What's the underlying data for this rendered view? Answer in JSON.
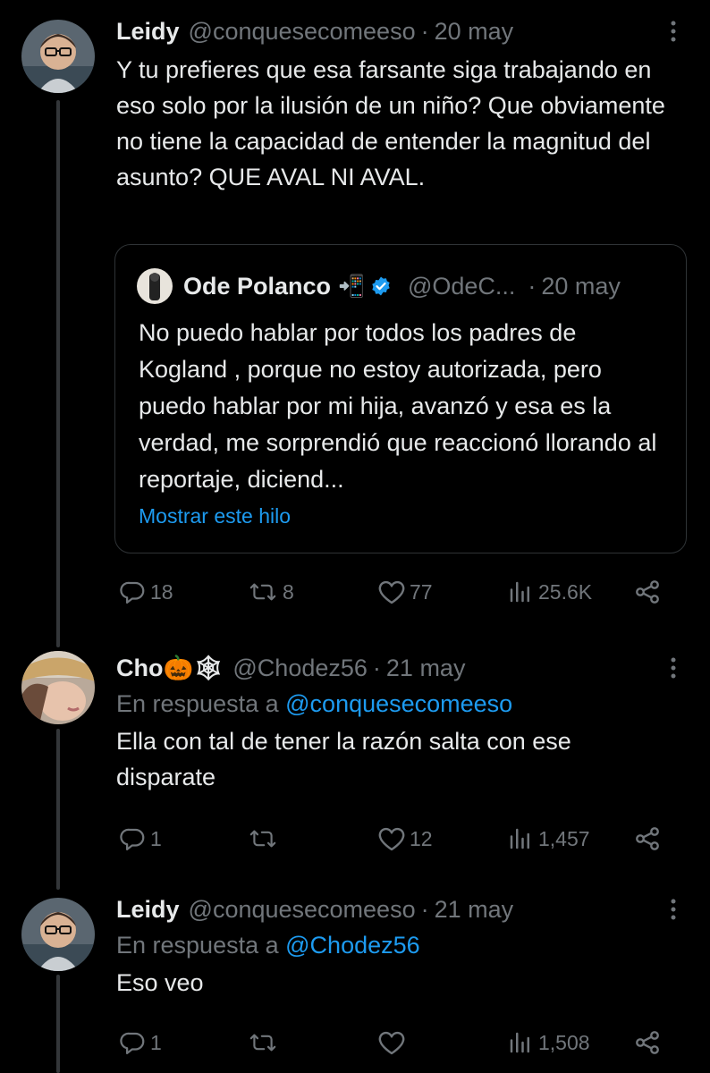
{
  "colors": {
    "background": "#000000",
    "text": "#e7e9ea",
    "muted": "#71767b",
    "link": "#1d9bf0",
    "border": "#2f3336",
    "verified": "#1d9bf0"
  },
  "tweets": [
    {
      "name": "Leidy",
      "handle": "@conquesecomeeso",
      "date": "20 may",
      "text": "Y tu prefieres que esa farsante siga trabajando en eso solo por la ilusión de un niño? Que obviamente no tiene la capacidad de entender la magnitud del asunto? QUE AVAL NI AVAL.",
      "quote": {
        "name": "Ode Polanco",
        "emoji": "📲",
        "verified": true,
        "handle": "@OdeC...",
        "date": "20 may",
        "text": "No puedo hablar por todos los padres de Kogland , porque no estoy autorizada, pero puedo hablar por mi hija, avanzó y esa es la verdad, me sorprendió que reaccionó llorando al reportaje, diciend...",
        "show_thread": "Mostrar este hilo"
      },
      "stats": {
        "replies": "18",
        "retweets": "8",
        "likes": "77",
        "views": "25.6K"
      }
    },
    {
      "name": "Cho🎃🕸",
      "handle": "@Chodez56",
      "date": "21 may",
      "reply_prefix": "En respuesta a",
      "reply_to": "@conquesecomeeso",
      "text": "Ella con tal de tener la razón salta con ese disparate",
      "stats": {
        "replies": "1",
        "retweets": "",
        "likes": "12",
        "views": "1,457"
      }
    },
    {
      "name": "Leidy",
      "handle": "@conquesecomeeso",
      "date": "21 may",
      "reply_prefix": "En respuesta a",
      "reply_to": "@Chodez56",
      "text": "Eso veo",
      "stats": {
        "replies": "1",
        "retweets": "",
        "likes": "",
        "views": "1,508"
      }
    }
  ]
}
